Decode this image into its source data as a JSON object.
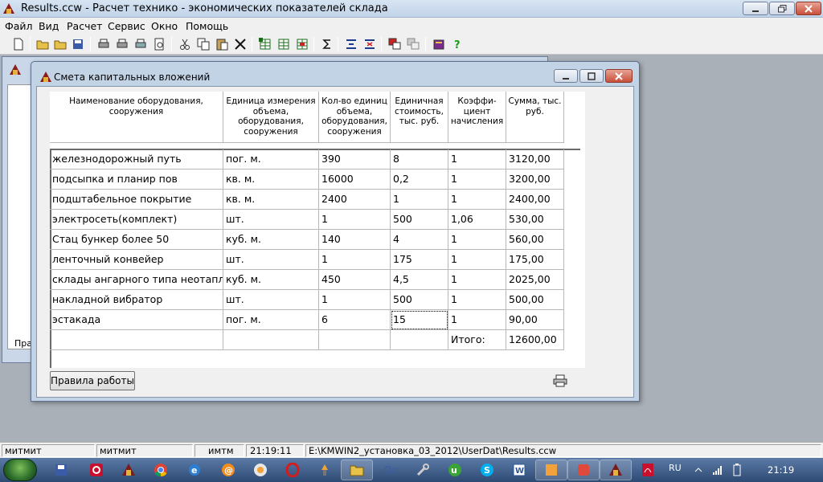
{
  "window": {
    "title": "Results.ccw - Расчет технико - экономических показателей склада"
  },
  "menu": [
    "Файл",
    "Вид",
    "Расчет",
    "Сервис",
    "Окно",
    "Помощь"
  ],
  "background_window": {
    "label": "Пра"
  },
  "dialog": {
    "title": "Смета капитальных вложений",
    "columns": [
      "Наименование оборудования, сооружения",
      "Единица измерения объема, оборудования, сооружения",
      "Кол-во единиц объема, оборудования, сооружения",
      "Единичная стоимость, тыс. руб.",
      "Коэффи- циент начисления",
      "Сумма, тыс. руб."
    ],
    "rows": [
      [
        " железнодорожный путь",
        "пог. м.",
        "390",
        "8",
        "1",
        "3120,00"
      ],
      [
        " подсыпка и планир пов",
        "кв. м.",
        "16000",
        "0,2",
        "1",
        "3200,00"
      ],
      [
        "подштабельное покрытие",
        "кв. м.",
        "2400",
        "1",
        "1",
        "2400,00"
      ],
      [
        " электросеть(комплект)",
        "шт.",
        "1",
        "500",
        "1,06",
        "530,00"
      ],
      [
        "Стац бункер  более 50",
        "куб. м.",
        "140",
        "4",
        "1",
        "560,00"
      ],
      [
        "ленточный конвейер",
        "шт.",
        "1",
        "175",
        "1",
        "175,00"
      ],
      [
        "склады ангарного типа неотапл",
        "куб. м.",
        "450",
        "4,5",
        "1",
        "2025,00"
      ],
      [
        "накладной вибратор",
        "шт.",
        "1",
        "500",
        "1",
        "500,00"
      ],
      [
        "эстакада",
        "пог. м.",
        "6",
        "15",
        "1",
        "90,00"
      ]
    ],
    "total_label": "Итого:",
    "total_value": "12600,00",
    "rules_button": "Правила работы"
  },
  "statusbar": {
    "user1": "митмит",
    "user2": "митмит",
    "code": "имтм",
    "time": "21:19:11",
    "path": "E:\\KMWIN2_установка_03_2012\\UserDat\\Results.ccw"
  },
  "taskbar": {
    "lang": "RU",
    "clock": "21:19"
  }
}
